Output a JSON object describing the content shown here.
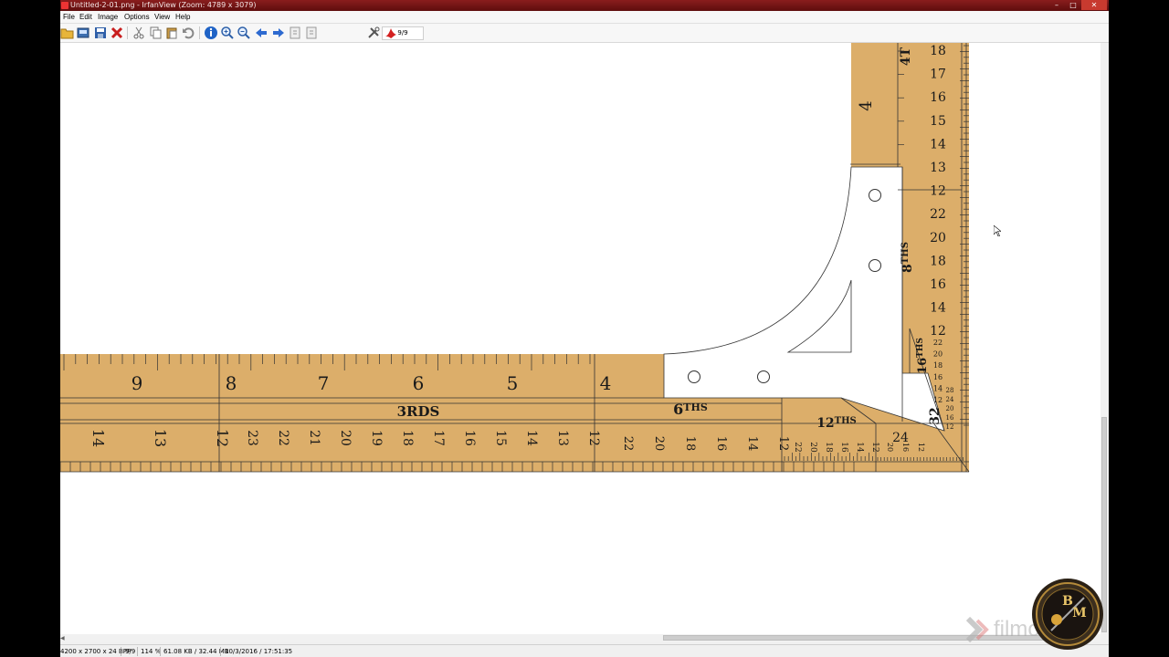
{
  "window": {
    "title": "Untitled-2-01.png - IrfanView (Zoom: 4789 x 3079)",
    "controls": {
      "minimize": "–",
      "maximize": "□",
      "close": "✕"
    }
  },
  "menu": [
    "File",
    "Edit",
    "Image",
    "Options",
    "View",
    "Help"
  ],
  "toolbar": {
    "buttons": [
      "open-folder-icon",
      "slideshow-icon",
      "save-icon",
      "delete-icon",
      "cut-icon",
      "copy-icon",
      "paste-icon",
      "undo-icon",
      "info-icon",
      "zoom-in-icon",
      "zoom-out-icon",
      "previous-icon",
      "next-icon",
      "first-page-icon",
      "last-page-icon",
      "settings-icon",
      "irfanview-logo-icon"
    ],
    "page_counter": "9/9"
  },
  "image": {
    "horizontal_arm": {
      "top_numbers": [
        "9",
        "8",
        "7",
        "6",
        "5",
        "4"
      ],
      "label_3rds": "3RDS",
      "label_6ths": "6",
      "label_6ths_sup": "THS",
      "label_12ths": "12",
      "label_12ths_sup": "THS",
      "bottom_numbers_left": [
        "14",
        "13",
        "12"
      ],
      "bottom_numbers_mid": [
        "23",
        "22",
        "21",
        "20",
        "19",
        "18",
        "17",
        "16",
        "15",
        "14",
        "13",
        "12"
      ],
      "bottom_numbers_6ths": [
        "22",
        "20",
        "18",
        "16",
        "14",
        "12"
      ],
      "bottom_numbers_12ths": [
        "22",
        "20",
        "18",
        "16",
        "14",
        "12"
      ],
      "corner_small": [
        "24",
        "20",
        "16",
        "12"
      ]
    },
    "vertical_arm": {
      "label_4ths_top": "4T",
      "inner_number": "4",
      "outer_numbers": [
        "18",
        "17",
        "16",
        "15",
        "14",
        "13",
        "12",
        "22",
        "20",
        "18",
        "16",
        "14",
        "12"
      ],
      "label_8ths": "8",
      "label_8ths_sup": "THS",
      "label_16ths": "16",
      "label_16ths_sup": "THS",
      "sixteenths_numbers": [
        "22",
        "20",
        "18",
        "16",
        "14",
        "12"
      ],
      "label_32": "32",
      "corner_32_numbers": [
        "28",
        "24",
        "20",
        "16",
        "12"
      ]
    }
  },
  "status": {
    "dimensions": "4200 x 2700 x 24 BPP",
    "page": "9/9",
    "zoom": "114 %",
    "size": "61.08 KB / 32.44 MB",
    "datetime": "10/3/2016 / 17:51:35"
  },
  "overlay": {
    "watermark": "filmora",
    "logo_letters": [
      "B",
      "M"
    ]
  },
  "colors": {
    "ruler": "#dcae6a",
    "title_bar": "#7a1414",
    "ink": "#1a1a1a"
  }
}
